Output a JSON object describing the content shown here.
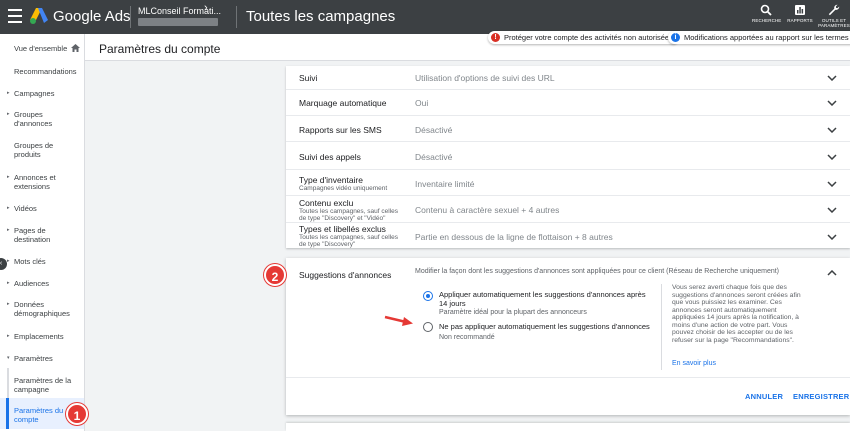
{
  "topbar": {
    "brand": "Google Ads",
    "account_name": "MLConseil Formati...",
    "page_title": "Toutes les campagnes",
    "tools": [
      {
        "label": "RECHERCHE",
        "icon": "search-icon"
      },
      {
        "label": "RAPPORTS",
        "icon": "reports-icon"
      },
      {
        "label_line1": "OUTILS ET",
        "label_line2": "PARAMÈTRES",
        "icon": "wrench-icon"
      }
    ]
  },
  "notifications": [
    {
      "text": "Protéger votre compte des activités non autorisées",
      "color": "#d93025",
      "glyph": "!"
    },
    {
      "text": "Modifications apportées au rapport sur les termes de",
      "color": "#1a73e8",
      "glyph": "i"
    }
  ],
  "sidebar": {
    "items": [
      {
        "label": "Vue d'ensemble"
      },
      {
        "label": "Recommandations"
      },
      {
        "label": "Campagnes"
      },
      {
        "label_line1": "Groupes",
        "label_line2": "d'annonces"
      },
      {
        "label_line1": "Groupes de",
        "label_line2": "produits"
      },
      {
        "label_line1": "Annonces et",
        "label_line2": "extensions"
      },
      {
        "label": "Vidéos"
      },
      {
        "label_line1": "Pages de",
        "label_line2": "destination"
      },
      {
        "label": "Mots clés"
      },
      {
        "label": "Audiences"
      },
      {
        "label_line1": "Données",
        "label_line2": "démographiques"
      },
      {
        "label": "Emplacements"
      },
      {
        "label": "Paramètres"
      },
      {
        "label_line1": "Paramètres de la",
        "label_line2": "campagne"
      },
      {
        "label_line1": "Paramètres du",
        "label_line2": "compte"
      }
    ]
  },
  "main": {
    "title": "Paramètres du compte",
    "rows": [
      {
        "name": "Suivi",
        "value": "Utilisation d'options de suivi des URL"
      },
      {
        "name": "Marquage automatique",
        "value": "Oui"
      },
      {
        "name": "Rapports sur les SMS",
        "value": "Désactivé"
      },
      {
        "name": "Suivi des appels",
        "value": "Désactivé"
      },
      {
        "name": "Type d'inventaire",
        "sub": "Campagnes vidéo uniquement",
        "value": "Inventaire limité"
      },
      {
        "name": "Contenu exclu",
        "sub1": "Toutes les campagnes, sauf celles",
        "sub2": "de type \"Discovery\" et \"Vidéo\"",
        "value": "Contenu à caractère sexuel + 4 autres"
      },
      {
        "name": "Types et libellés exclus",
        "sub1": "Toutes les campagnes, sauf celles",
        "sub2": "de type \"Discovery\"",
        "value": "Partie en dessous de la ligne de flottaison + 8 autres"
      }
    ],
    "suggestions": {
      "name": "Suggestions d'annonces",
      "description": "Modifier la façon dont les suggestions d'annonces sont appliquées pour ce client (Réseau de Recherche uniquement)",
      "option1_line1": "Appliquer automatiquement les suggestions d'annonces après",
      "option1_line2": "14 jours",
      "option1_hint": "Paramètre idéal pour la plupart des annonceurs",
      "option2": "Ne pas appliquer automatiquement les suggestions d'annonces",
      "option2_hint": "Non recommandé",
      "info_lines": [
        "Vous serez averti chaque fois que des",
        "suggestions d'annonces seront créées afin",
        "que vous puissiez les examiner. Ces",
        "annonces seront automatiquement",
        "appliquées 14 jours après la notification, à",
        "moins d'une action de votre part. Vous",
        "pouvez choisir de les accepter ou de les",
        "refuser sur la page \"Recommandations\"."
      ],
      "learn_more": "En savoir plus",
      "cancel": "ANNULER",
      "save": "ENREGISTRER"
    }
  },
  "annotations": {
    "badge1": "1",
    "badge2": "2"
  }
}
